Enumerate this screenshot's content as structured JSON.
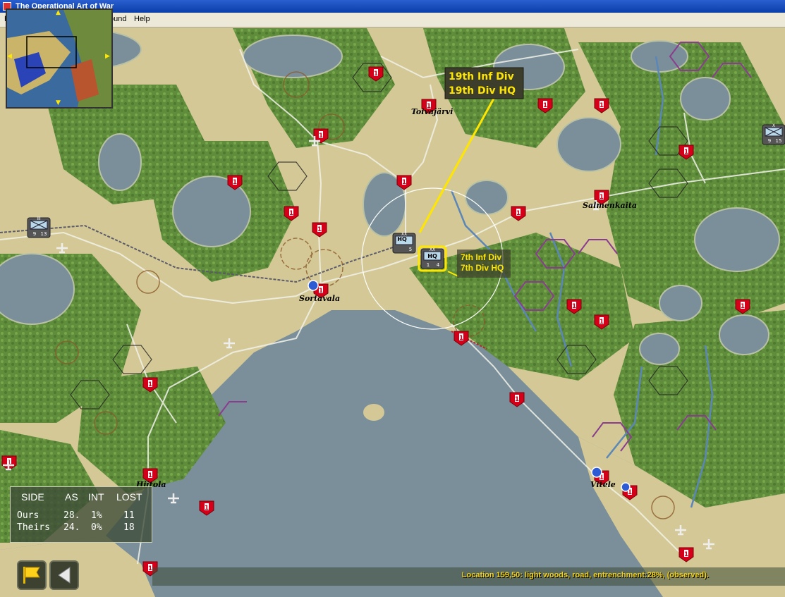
{
  "window": {
    "title": "The Operational Art of War"
  },
  "menu": {
    "item_first": "F",
    "item_round": "ound",
    "item_help": "Help"
  },
  "map": {
    "place_names": [
      "Toivajärvi",
      "Sortavala",
      "Salmenkaita",
      "Hiitola",
      "Vitele"
    ],
    "unit_icon": "red-shield-unit-icon",
    "enemy_value": "1",
    "unit_cards": [
      {
        "name": "unit-card-hq-19th",
        "type": "HQ",
        "echelon": "XX",
        "strength": "",
        "moves": "5"
      },
      {
        "name": "unit-card-hq-7th",
        "type": "HQ",
        "echelon": "XX",
        "strength": "1",
        "moves": "4"
      },
      {
        "name": "unit-card-inf-west",
        "type": "",
        "echelon": "III",
        "strength": "9",
        "moves": "13"
      },
      {
        "name": "unit-card-inf-east",
        "type": "",
        "echelon": "X",
        "strength": "9",
        "moves": "15"
      }
    ]
  },
  "tooltip_primary": {
    "line1": "19th Inf Div",
    "line2": "19th Div HQ"
  },
  "tooltip_secondary": {
    "line1": "7th Inf Div",
    "line2": "7th Div HQ"
  },
  "stats": {
    "headers": [
      "SIDE",
      "AS",
      "INT",
      "LOST"
    ],
    "rows": [
      {
        "side": "Ours",
        "as": "28.",
        "int": "1%",
        "lost": "11"
      },
      {
        "side": "Theirs",
        "as": "24.",
        "int": "0%",
        "lost": "18"
      }
    ]
  },
  "controls": {
    "flag_icon": "flag-icon",
    "back_icon": "back-arrow-icon"
  },
  "status": {
    "text": "Location 159,50: light woods, road, entrenchment:28%, (observed)."
  },
  "colors": {
    "enemy_red": "#d4001a",
    "tooltip_yellow": "#ffe600",
    "water": "#7a8f9a",
    "forest": "#5d8a3a",
    "clear": "#d4c996"
  }
}
